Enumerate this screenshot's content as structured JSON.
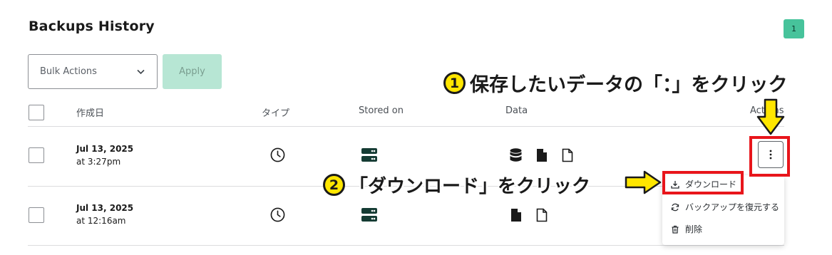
{
  "page": {
    "title": "Backups History",
    "count_badge": "1"
  },
  "bulk": {
    "select_value": "Bulk Actions",
    "apply_label": "Apply"
  },
  "table": {
    "headers": {
      "created": "作成日",
      "type": "タイプ",
      "stored_on": "Stored on",
      "data": "Data",
      "actions": "Actions"
    },
    "rows": [
      {
        "date": "Jul 13, 2025",
        "time": "at 3:27pm",
        "type_icon": "clock-icon",
        "stored_icon": "server-icon",
        "data_icons": [
          "database-icon",
          "file-filled-icon",
          "file-outline-icon"
        ]
      },
      {
        "date": "Jul 13, 2025",
        "time": "at 12:16am",
        "type_icon": "clock-icon",
        "stored_icon": "server-icon",
        "data_icons": [
          "file-filled-icon",
          "file-outline-icon"
        ]
      }
    ]
  },
  "dropdown": {
    "items": [
      {
        "label": "ダウンロード",
        "icon": "download-icon"
      },
      {
        "label": "バックアップを復元する",
        "icon": "restore-icon"
      },
      {
        "label": "削除",
        "icon": "trash-icon"
      }
    ]
  },
  "annotations": {
    "step1": {
      "number": "1",
      "text": "保存したいデータの「：」をクリック"
    },
    "step2": {
      "number": "2",
      "text": "「ダウンロード」をクリック"
    }
  },
  "colors": {
    "accent": "#47c39b",
    "apply_disabled": "#b7e6d4",
    "icon_dark": "#143b33",
    "highlight_red": "#e8151b",
    "callout_yellow": "#ffe600"
  }
}
